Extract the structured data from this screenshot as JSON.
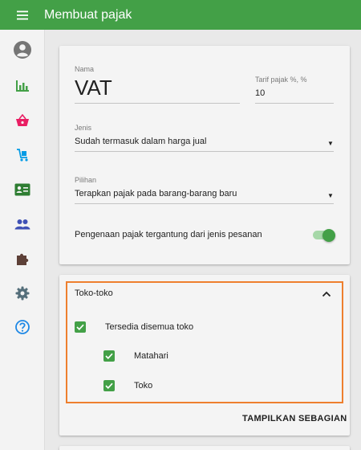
{
  "appbar": {
    "title": "Membuat pajak",
    "color": "#43a047"
  },
  "sidebar": {
    "items": [
      {
        "name": "account",
        "icon": "account-circle-icon",
        "color": "#757575"
      },
      {
        "name": "reports",
        "icon": "bar-chart-icon",
        "color": "#43a047"
      },
      {
        "name": "sales",
        "icon": "basket-icon",
        "color": "#e91e63"
      },
      {
        "name": "inventory",
        "icon": "cart-icon",
        "color": "#039be5"
      },
      {
        "name": "customers",
        "icon": "contact-card-icon",
        "color": "#2e7d32"
      },
      {
        "name": "employees",
        "icon": "people-icon",
        "color": "#3f51b5"
      },
      {
        "name": "integrations",
        "icon": "puzzle-icon",
        "color": "#5d4037"
      },
      {
        "name": "settings",
        "icon": "gear-icon",
        "color": "#546e7a"
      },
      {
        "name": "help",
        "icon": "help-icon",
        "color": "#1e88e5"
      }
    ]
  },
  "tax_form": {
    "name_label": "Nama",
    "name_value": "VAT",
    "rate_label": "Tarif pajak %, %",
    "rate_value": "10",
    "type_label": "Jenis",
    "type_value": "Sudah termasuk dalam harga jual",
    "option_label": "Pilihan",
    "option_value": "Terapkan pajak pada barang-barang baru",
    "order_type_toggle_label": "Pengenaan pajak tergantung dari jenis pesanan",
    "order_type_toggle_on": true
  },
  "stores": {
    "header": "Toko-toko",
    "all_label": "Tersedia disemua toko",
    "all_checked": true,
    "items": [
      {
        "label": "Matahari",
        "checked": true
      },
      {
        "label": "Toko",
        "checked": true
      }
    ],
    "show_partial_label": "TAMPILKAN SEBAGIAN",
    "highlight_color": "#ee7f2e"
  }
}
